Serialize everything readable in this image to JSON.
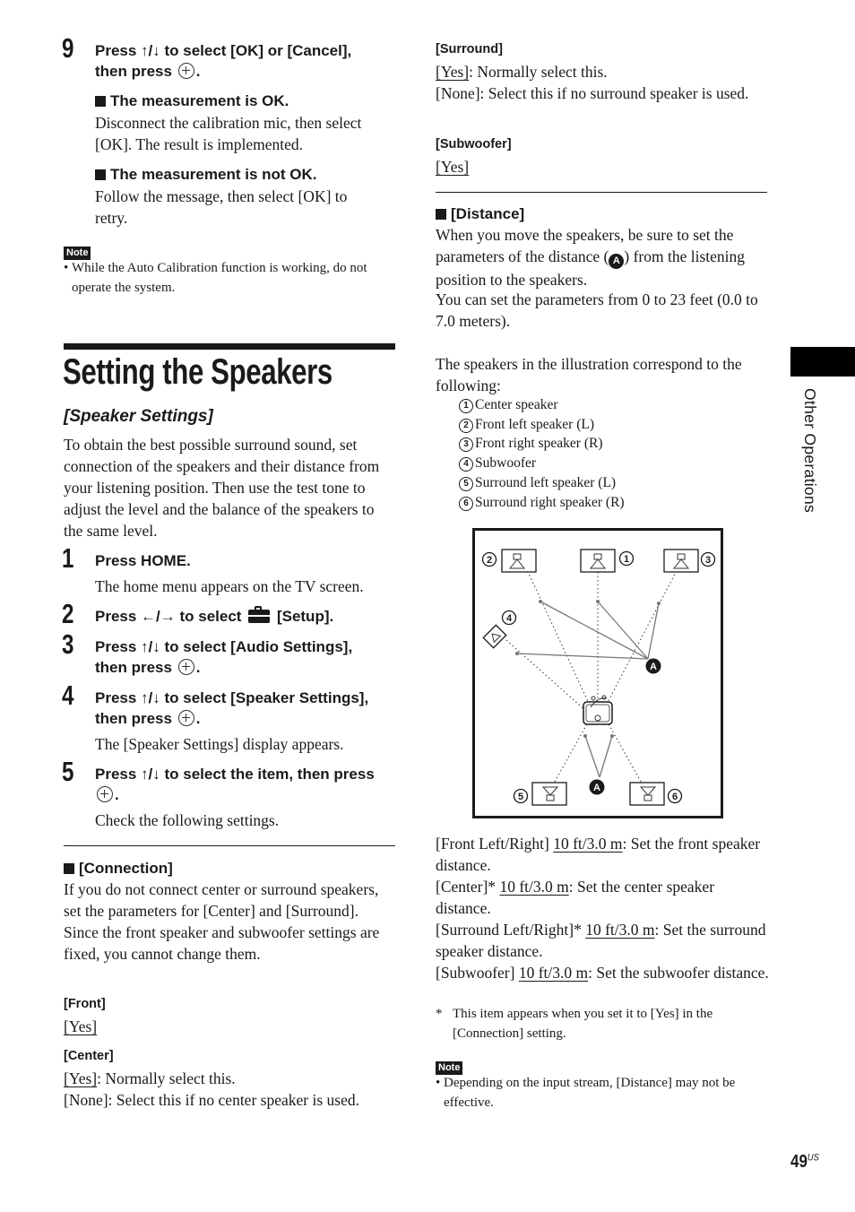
{
  "step9": {
    "number": "9",
    "instruction_line1": "Press ↑/↓ to select [OK] or [Cancel],",
    "instruction_line2": "then press",
    "ok_heading": "The measurement is OK.",
    "ok_text": "Disconnect the calibration mic, then select [OK]. The result is implemented.",
    "notok_heading": "The measurement is not OK.",
    "notok_text": "Follow the message, then select [OK] to retry."
  },
  "note1": {
    "label": "Note",
    "text": "While the Auto Calibration function is working, do not operate the system."
  },
  "section": {
    "title": "Setting the Speakers",
    "subtitle": "[Speaker Settings]",
    "intro": "To obtain the best possible surround sound, set connection of the speakers and their distance from your listening position. Then use the test tone to adjust the level and the balance of the speakers to the same level."
  },
  "steps": [
    {
      "number": "1",
      "instruction": "Press HOME.",
      "result": "The home menu appears on the TV screen."
    },
    {
      "number": "2",
      "instruction_pre": "Press ←/→ to select",
      "instruction_post": "[Setup].",
      "icon": "toolbox-icon"
    },
    {
      "number": "3",
      "instruction_line1": "Press ↑/↓ to select [Audio Settings],",
      "instruction_line2": "then press"
    },
    {
      "number": "4",
      "instruction_line1": "Press ↑/↓ to select [Speaker Settings],",
      "instruction_line2": "then press",
      "result": "The [Speaker Settings] display appears."
    },
    {
      "number": "5",
      "instruction_line1": "Press ↑/↓ to select the item, then press",
      "result": "Check the following settings."
    }
  ],
  "connection": {
    "heading": "[Connection]",
    "text": "If you do not connect center or surround speakers, set the parameters for [Center] and [Surround]. Since the front speaker and subwoofer settings are fixed, you cannot change them.",
    "front": {
      "label": "[Front]",
      "value": "[Yes]"
    },
    "center": {
      "label": "[Center]",
      "yes": "[Yes]",
      "yes_desc": ": Normally select this.",
      "none": "[None]: Select this if no center speaker is used."
    },
    "surround": {
      "label": "[Surround]",
      "yes": "[Yes]",
      "yes_desc": ": Normally select this.",
      "none": "[None]: Select this if no surround speaker is used."
    },
    "subwoofer": {
      "label": "[Subwoofer]",
      "value": "[Yes]"
    }
  },
  "distance": {
    "heading": "[Distance]",
    "text_pre": "When you move the speakers, be sure to set the parameters of the distance (",
    "badge": "A",
    "text_post": ") from the listening position to the speakers.",
    "range": "You can set the parameters from 0 to 23 feet (0.0 to 7.0 meters).",
    "legend_intro": "The speakers in the illustration correspond to the following:",
    "legend": [
      {
        "num": "1",
        "label": "Center speaker"
      },
      {
        "num": "2",
        "label": "Front left speaker (L)"
      },
      {
        "num": "3",
        "label": "Front right speaker (R)"
      },
      {
        "num": "4",
        "label": "Subwoofer"
      },
      {
        "num": "5",
        "label": "Surround left speaker (L)"
      },
      {
        "num": "6",
        "label": "Surround right speaker (R)"
      }
    ],
    "diagram_marker": "A",
    "settings": [
      {
        "label": "[Front Left/Right]",
        "value": "10 ft/3.0 m",
        "desc": ": Set the front speaker distance."
      },
      {
        "label": "[Center]*",
        "value": "10 ft/3.0 m",
        "desc": ": Set the center speaker distance."
      },
      {
        "label": "[Surround Left/Right]*",
        "value": "10 ft/3.0 m",
        "desc": ": Set the surround speaker distance."
      },
      {
        "label": "[Subwoofer]",
        "value": "10 ft/3.0 m",
        "desc": ": Set the subwoofer distance."
      }
    ],
    "footnote_mark": "*",
    "footnote": "This item appears when you set it to [Yes] in the [Connection] setting."
  },
  "note2": {
    "label": "Note",
    "text": "Depending on the input stream, [Distance] may not be effective."
  },
  "side_tab": {
    "label": "Other Operations"
  },
  "page": {
    "number": "49",
    "suffix": "US"
  }
}
